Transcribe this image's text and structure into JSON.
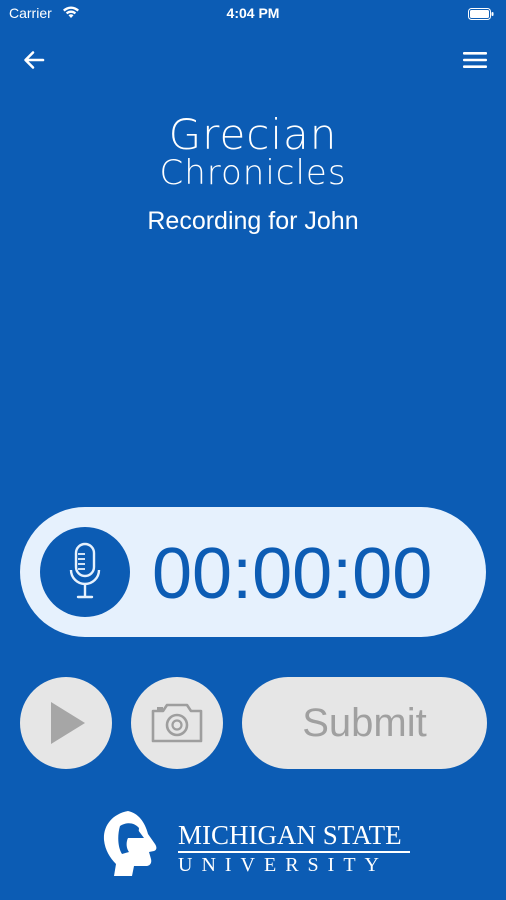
{
  "status_bar": {
    "carrier": "Carrier",
    "time": "4:04 PM",
    "icons": [
      "wifi-icon",
      "battery-icon"
    ]
  },
  "nav": {
    "back_icon": "arrow-left-icon",
    "menu_icon": "hamburger-menu-icon"
  },
  "logo": {
    "line1": "Grecian",
    "line2": "Chronicles"
  },
  "subtitle": "Recording for John",
  "recorder": {
    "mic_icon": "microphone-icon",
    "timer": "00:00:00"
  },
  "controls": {
    "play_icon": "play-icon",
    "camera_icon": "camera-icon",
    "submit_label": "Submit"
  },
  "footer": {
    "line1": "MICHIGAN STATE",
    "line2": "UNIVERSITY",
    "logo_icon": "spartan-helmet-icon"
  },
  "colors": {
    "background": "#0c5cb4",
    "pill": "#e6f1fd",
    "disabled": "#e6e6e6",
    "disabled_text": "#a0a0a0"
  }
}
